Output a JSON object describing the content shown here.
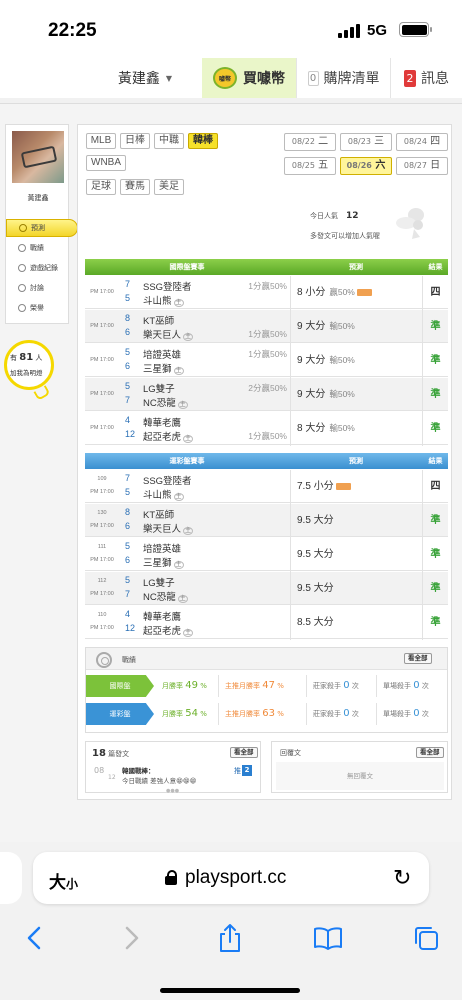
{
  "status_bar": {
    "time": "22:25",
    "network": "5G"
  },
  "top_nav": {
    "user": "黃建鑫",
    "coin_label": "買噱幣",
    "coin_icon_text": "噱幣",
    "bought_label": "購牌清單",
    "bought_count": "0",
    "msg_label": "訊息",
    "msg_count": "2"
  },
  "sidebar": {
    "name": "黃建鑫",
    "items": [
      {
        "label": "預測",
        "icon": "target-icon",
        "active": true
      },
      {
        "label": "戰績",
        "icon": "chart-icon"
      },
      {
        "label": "遊戲紀錄",
        "icon": "record-icon"
      },
      {
        "label": "討論",
        "icon": "chat-icon"
      },
      {
        "label": "榮譽",
        "icon": "medal-icon"
      }
    ],
    "bulb_prefix": "有",
    "bulb_count": "81",
    "bulb_suffix": "人",
    "bulb_text": "加我為明燈"
  },
  "league_tags": [
    "MLB",
    "日棒",
    "中職",
    "韓棒",
    "WNBA",
    "足球",
    "賽馬",
    "美足"
  ],
  "active_tag": "韓棒",
  "dates": [
    {
      "date": "08/22",
      "day": "二"
    },
    {
      "date": "08/23",
      "day": "三"
    },
    {
      "date": "08/24",
      "day": "四"
    },
    {
      "date": "08/25",
      "day": "五"
    },
    {
      "date": "08/26",
      "day": "六",
      "active": true
    },
    {
      "date": "08/27",
      "day": "日"
    }
  ],
  "popularity": {
    "label": "今日人氣",
    "value": "12",
    "hint": "多發文可以增加人氣喔"
  },
  "intl_table": {
    "headers": [
      "國際盤賽事",
      "預測",
      "結果"
    ],
    "rows": [
      {
        "time": "PM 17:00",
        "n1": "7",
        "t1": "SSG登陸者",
        "n2": "5",
        "t2": "斗山熊",
        "home": "主",
        "o1": "1分贏50%",
        "o2": "",
        "pred": "8 小分",
        "pred_sub": "贏50%",
        "flag": true,
        "res": "四",
        "res_class": "lose"
      },
      {
        "time": "PM 17:00",
        "n1": "8",
        "t1": "KT巫師",
        "n2": "6",
        "t2": "樂天巨人",
        "home": "主",
        "o1": "",
        "o2": "1分贏50%",
        "pred": "9 大分",
        "pred_sub": "輸50%",
        "flag": false,
        "res": "準",
        "res_class": "ok"
      },
      {
        "time": "PM 17:00",
        "n1": "5",
        "t1": "培證英雄",
        "n2": "6",
        "t2": "三星獅",
        "home": "主",
        "o1": "1分贏50%",
        "o2": "",
        "pred": "9 大分",
        "pred_sub": "輸50%",
        "flag": false,
        "res": "準",
        "res_class": "ok"
      },
      {
        "time": "PM 17:00",
        "n1": "5",
        "t1": "LG雙子",
        "n2": "7",
        "t2": "NC恐龍",
        "home": "主",
        "o1": "2分贏50%",
        "o2": "",
        "pred": "9 大分",
        "pred_sub": "輸50%",
        "flag": false,
        "res": "準",
        "res_class": "ok"
      },
      {
        "time": "PM 17:00",
        "n1": "4",
        "t1": "韓華老鷹",
        "n2": "12",
        "t2": "起亞老虎",
        "home": "主",
        "o1": "",
        "o2": "1分贏50%",
        "pred": "8 大分",
        "pred_sub": "輸50%",
        "flag": false,
        "res": "準",
        "res_class": "ok"
      }
    ]
  },
  "lottery_table": {
    "headers": [
      "運彩盤賽事",
      "預測",
      "結果"
    ],
    "rows": [
      {
        "num": "109",
        "time": "PM 17:00",
        "n1": "7",
        "t1": "SSG登陸者",
        "n2": "5",
        "t2": "斗山熊",
        "home": "主",
        "pred": "7.5 小分",
        "flag": true,
        "res": "四",
        "res_class": "lose"
      },
      {
        "num": "130",
        "time": "PM 17:00",
        "n1": "8",
        "t1": "KT巫師",
        "n2": "6",
        "t2": "樂天巨人",
        "home": "主",
        "pred": "9.5 大分",
        "flag": false,
        "res": "準",
        "res_class": "ok"
      },
      {
        "num": "111",
        "time": "PM 17:00",
        "n1": "5",
        "t1": "培證英雄",
        "n2": "6",
        "t2": "三星獅",
        "home": "主",
        "pred": "9.5 大分",
        "flag": false,
        "res": "準",
        "res_class": "ok"
      },
      {
        "num": "112",
        "time": "PM 17:00",
        "n1": "5",
        "t1": "LG雙子",
        "n2": "7",
        "t2": "NC恐龍",
        "home": "主",
        "pred": "9.5 大分",
        "flag": false,
        "res": "準",
        "res_class": "ok"
      },
      {
        "num": "110",
        "time": "PM 17:00",
        "n1": "4",
        "t1": "韓華老鷹",
        "n2": "12",
        "t2": "起亞老虎",
        "home": "主",
        "pred": "8.5 大分",
        "flag": false,
        "res": "準",
        "res_class": "ok"
      }
    ]
  },
  "record": {
    "title": "戰績",
    "view_all": "看全部",
    "rows": [
      {
        "tab": "國際盤",
        "color": "#7cc23a",
        "month_label": "月勝率",
        "month": "49",
        "main_label": "主推月勝率",
        "main": "47",
        "dealer_label": "莊家殺手",
        "dealer": "0",
        "dealer_unit": "次",
        "single_label": "單場殺手",
        "single": "0",
        "single_unit": "次"
      },
      {
        "tab": "運彩盤",
        "color": "#3a93d6",
        "month_label": "月勝率",
        "month": "54",
        "main_label": "主推月勝率",
        "main": "63",
        "dealer_label": "莊家殺手",
        "dealer": "0",
        "dealer_unit": "次",
        "single_label": "單場殺手",
        "single": "0",
        "single_unit": "次"
      }
    ]
  },
  "posts": {
    "count": "18",
    "label": "篇發文",
    "view_all": "看全部",
    "item_date_m": "08",
    "item_date_d": "12",
    "item_title": "韓國戰棒：",
    "item_text": "今日戰績 差強人意😁😁😁",
    "push_label": "推",
    "push_count": "2"
  },
  "replies": {
    "label": "回覆文",
    "view_all": "看全部",
    "empty": "無回覆文"
  },
  "browser": {
    "text_size": "大",
    "text_size_small": "小",
    "url": "playsport.cc"
  }
}
